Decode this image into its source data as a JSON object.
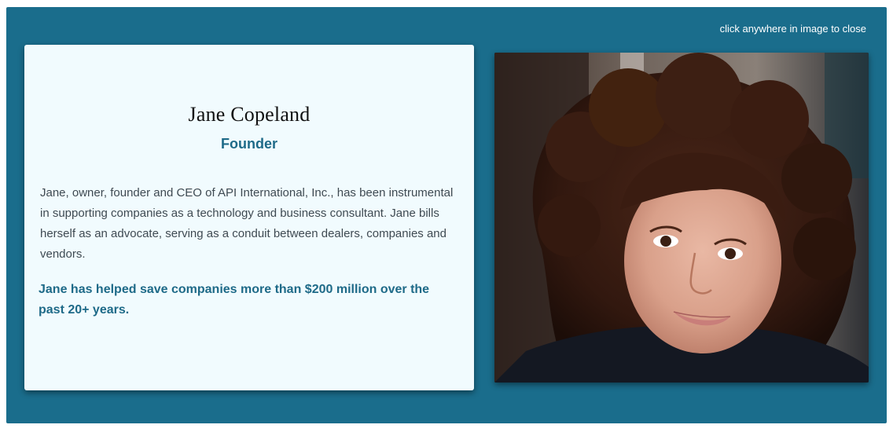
{
  "modal": {
    "close_hint": "click anywhere in image to close",
    "background_color": "#1a6d8c"
  },
  "bio": {
    "name": "Jane Copeland",
    "title": "Founder",
    "description": "Jane, owner, founder and CEO of API International, Inc., has been instrumental in supporting companies as a technology and business consultant. Jane bills herself as an advocate, serving as a conduit between dealers, companies and vendors.",
    "highlight": "Jane has helped save companies more than $200 million over the past 20+ years.",
    "accent_color": "#1e6a88",
    "card_color": "#f1fbfe"
  },
  "photo": {
    "subject": "portrait-photo"
  }
}
